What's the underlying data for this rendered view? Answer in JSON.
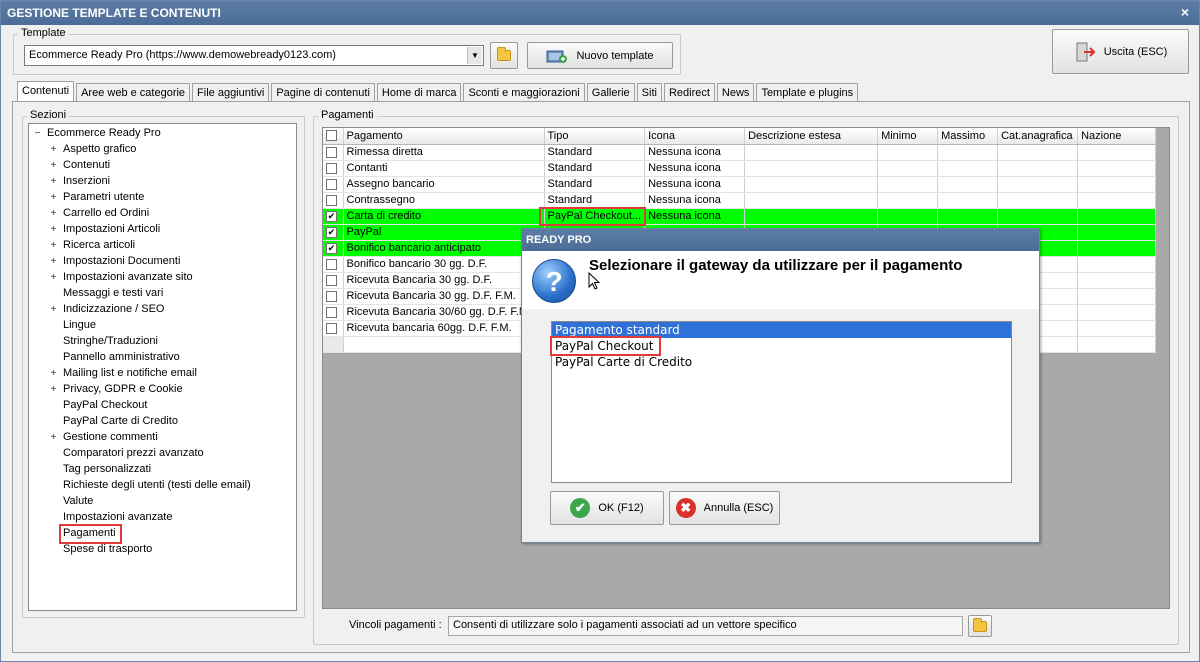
{
  "window": {
    "title": "GESTIONE TEMPLATE E CONTENUTI",
    "close_glyph": "×"
  },
  "template": {
    "group_label": "Template",
    "selected": "Ecommerce Ready Pro (https://www.demowebready0123.com)",
    "new_button": "Nuovo template",
    "exit_button": "Uscita (ESC)"
  },
  "tabs": [
    "Contenuti",
    "Aree web e categorie",
    "File aggiuntivi",
    "Pagine di contenuti",
    "Home di marca",
    "Sconti e maggiorazioni",
    "Gallerie",
    "Siti",
    "Redirect",
    "News",
    "Template e plugins"
  ],
  "sections": {
    "group_label": "Sezioni",
    "root": "Ecommerce Ready Pro",
    "root_toggle": "−",
    "expand_glyph": "+",
    "items": [
      {
        "label": "Aspetto grafico",
        "expandable": true
      },
      {
        "label": "Contenuti",
        "expandable": true
      },
      {
        "label": "Inserzioni",
        "expandable": true
      },
      {
        "label": "Parametri utente",
        "expandable": true
      },
      {
        "label": "Carrello ed Ordini",
        "expandable": true
      },
      {
        "label": "Impostazioni Articoli",
        "expandable": true
      },
      {
        "label": "Ricerca articoli",
        "expandable": true
      },
      {
        "label": "Impostazioni Documenti",
        "expandable": true
      },
      {
        "label": "Impostazioni avanzate sito",
        "expandable": true
      },
      {
        "label": "Messaggi e testi vari",
        "expandable": false
      },
      {
        "label": "Indicizzazione / SEO",
        "expandable": true
      },
      {
        "label": "Lingue",
        "expandable": false
      },
      {
        "label": "Stringhe/Traduzioni",
        "expandable": false
      },
      {
        "label": "Pannello amministrativo",
        "expandable": false
      },
      {
        "label": "Mailing list e notifiche email",
        "expandable": true
      },
      {
        "label": "Privacy, GDPR e Cookie",
        "expandable": true
      },
      {
        "label": "PayPal Checkout",
        "expandable": false
      },
      {
        "label": "PayPal Carte di Credito",
        "expandable": false
      },
      {
        "label": "Gestione commenti",
        "expandable": true
      },
      {
        "label": "Comparatori prezzi avanzato",
        "expandable": false
      },
      {
        "label": "Tag personalizzati",
        "expandable": false
      },
      {
        "label": "Richieste degli utenti (testi delle email)",
        "expandable": false
      },
      {
        "label": "Valute",
        "expandable": false
      },
      {
        "label": "Impostazioni avanzate",
        "expandable": false
      },
      {
        "label": "Pagamenti",
        "expandable": false,
        "highlighted": true
      },
      {
        "label": "Spese di trasporto",
        "expandable": false
      }
    ]
  },
  "payments": {
    "group_label": "Pagamenti",
    "check_glyph": "✔",
    "columns": [
      "Pagamento",
      "Tipo",
      "Icona",
      "Descrizione estesa",
      "Minimo",
      "Massimo",
      "Cat.anagrafica",
      "Nazione"
    ],
    "rows": [
      {
        "checked": false,
        "selected": false,
        "pagamento": "Rimessa diretta",
        "tipo": "Standard",
        "icona": "Nessuna icona"
      },
      {
        "checked": false,
        "selected": false,
        "pagamento": "Contanti",
        "tipo": "Standard",
        "icona": "Nessuna icona"
      },
      {
        "checked": false,
        "selected": false,
        "pagamento": "Assegno bancario",
        "tipo": "Standard",
        "icona": "Nessuna icona"
      },
      {
        "checked": false,
        "selected": false,
        "pagamento": "Contrassegno",
        "tipo": "Standard",
        "icona": "Nessuna icona"
      },
      {
        "checked": true,
        "selected": true,
        "pagamento": "Carta di credito",
        "tipo": "PayPal Checkout...",
        "icona": "Nessuna icona"
      },
      {
        "checked": true,
        "selected": true,
        "pagamento": "PayPal",
        "tipo": "",
        "icona": ""
      },
      {
        "checked": true,
        "selected": true,
        "pagamento": "Bonifico bancario anticipato",
        "tipo": "",
        "icona": ""
      },
      {
        "checked": false,
        "selected": false,
        "pagamento": "Bonifico bancario 30 gg. D.F.",
        "tipo": "",
        "icona": ""
      },
      {
        "checked": false,
        "selected": false,
        "pagamento": "Ricevuta Bancaria 30 gg. D.F.",
        "tipo": "",
        "icona": ""
      },
      {
        "checked": false,
        "selected": false,
        "pagamento": "Ricevuta Bancaria 30 gg. D.F. F.M.",
        "tipo": "",
        "icona": ""
      },
      {
        "checked": false,
        "selected": false,
        "pagamento": "Ricevuta Bancaria 30/60 gg. D.F. F.M.",
        "tipo": "",
        "icona": ""
      },
      {
        "checked": false,
        "selected": false,
        "pagamento": "Ricevuta bancaria 60gg. D.F. F.M.",
        "tipo": "",
        "icona": ""
      }
    ],
    "vincoli_label": "Vincoli pagamenti :",
    "vincoli_value": "Consenti di utilizzare solo i pagamenti associati ad un vettore specifico"
  },
  "dialog": {
    "title": "READY PRO",
    "question_glyph": "?",
    "message": "Selezionare il gateway da utilizzare per il pagamento",
    "options": [
      "Pagamento standard",
      "PayPal Checkout",
      "PayPal Carte di Credito"
    ],
    "selected_index": 0,
    "ok_button": "OK (F12)",
    "ok_glyph": "✔",
    "cancel_button": "Annulla (ESC)",
    "cancel_glyph": "✖"
  },
  "colors": {
    "selected_row": "#00ff00",
    "highlight": "#e03a3a",
    "titlebar": "#4f71a0",
    "list_selection": "#3071d8"
  }
}
